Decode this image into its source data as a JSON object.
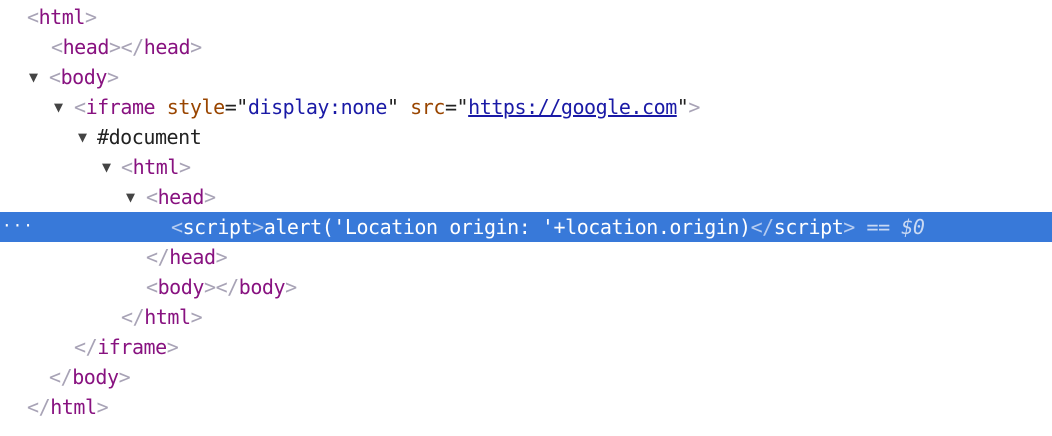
{
  "tokens": {
    "lt": "<",
    "gt": ">",
    "lt_slash": "</",
    "eq_quote": "=\"",
    "quote": "\"",
    "expand_triangle": "▼"
  },
  "tags": {
    "html": "html",
    "head": "head",
    "body": "body",
    "iframe": "iframe",
    "script": "script"
  },
  "iframe": {
    "attr_style": "style",
    "style_value": "display:none",
    "attr_src": "src",
    "src_value": "https://google.com"
  },
  "document_node": "#document",
  "script_text": "alert('Location origin: '+location.origin)",
  "selection": {
    "dots": "···",
    "equals": "==",
    "console_ref": "$0"
  }
}
